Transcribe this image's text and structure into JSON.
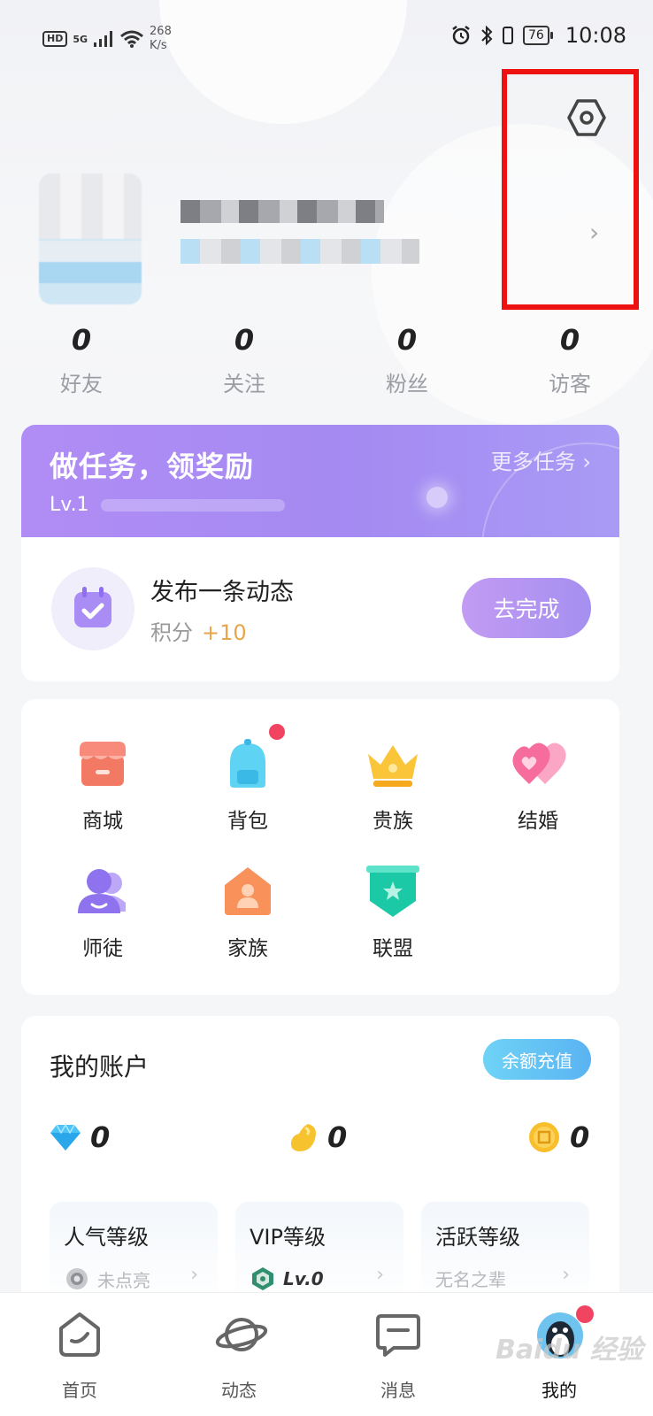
{
  "status_bar": {
    "hd": "HD",
    "signal": "5G",
    "net_speed_value": "268",
    "net_speed_unit": "K/s",
    "battery": "76",
    "time": "10:08"
  },
  "stats": [
    {
      "value": "0",
      "label": "好友"
    },
    {
      "value": "0",
      "label": "关注"
    },
    {
      "value": "0",
      "label": "粉丝"
    },
    {
      "value": "0",
      "label": "访客"
    }
  ],
  "task_card": {
    "title": "做任务，领奖励",
    "more_label": "更多任务 ›",
    "level": "Lv.1",
    "task_name": "发布一条动态",
    "points_label": "积分",
    "points_value": "+10",
    "action_label": "去完成"
  },
  "features": [
    {
      "label": "商城",
      "icon": "shop-icon"
    },
    {
      "label": "背包",
      "icon": "backpack-icon"
    },
    {
      "label": "贵族",
      "icon": "crown-icon"
    },
    {
      "label": "结婚",
      "icon": "hearts-icon"
    },
    {
      "label": "师徒",
      "icon": "mentor-icon"
    },
    {
      "label": "家族",
      "icon": "family-icon"
    },
    {
      "label": "联盟",
      "icon": "alliance-icon"
    }
  ],
  "account": {
    "title": "我的账户",
    "recharge_label": "余额充值",
    "diamonds": "0",
    "beans": "0",
    "coins": "0",
    "levels": [
      {
        "title": "人气等级",
        "status": "未点亮"
      },
      {
        "title": "VIP等级",
        "status": "Lv.0"
      },
      {
        "title": "活跃等级",
        "status": "无名之辈"
      }
    ]
  },
  "tabs": [
    {
      "label": "首页"
    },
    {
      "label": "动态"
    },
    {
      "label": "消息"
    },
    {
      "label": "我的"
    }
  ],
  "watermark": "Baidu 经验"
}
